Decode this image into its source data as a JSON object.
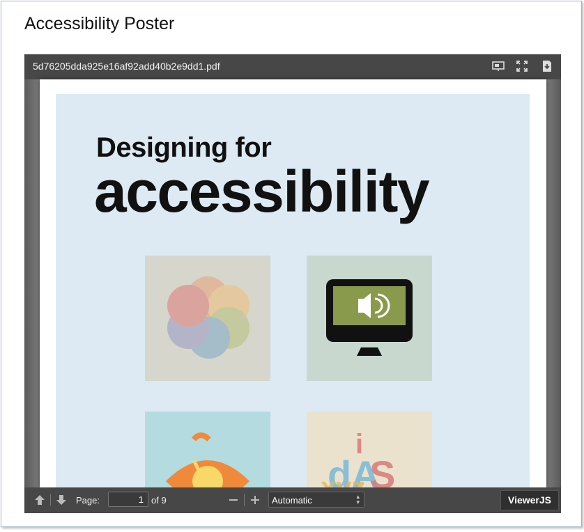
{
  "page": {
    "title": "Accessibility Poster"
  },
  "viewer": {
    "filename": "5d76205dda925e16af92add40b2e9dd1.pdf",
    "toolbar": {
      "page_label": "Page:",
      "page_value": "1",
      "page_total": "of 9",
      "zoom_value": "Automatic",
      "brand": "ViewerJS"
    },
    "icons": [
      "presentation-icon",
      "fullscreen-icon",
      "download-icon",
      "previous-page-icon",
      "next-page-icon",
      "zoom-out-icon",
      "zoom-in-icon",
      "dropdown-arrows-icon"
    ]
  },
  "poster": {
    "heading_line1": "Designing for",
    "heading_line2": "accessibility",
    "tile_colors": {
      "tile1": "#d6d6cc",
      "tile2": "#c9d8cf",
      "tile3": "#b3dbe0",
      "tile4": "#ebe2cd"
    },
    "watermark_text": "dAiS"
  },
  "colors": {
    "toolbar_bg": "#474747",
    "poster_bg": "#ddeaf4",
    "monitor_screen": "#899a4d"
  }
}
